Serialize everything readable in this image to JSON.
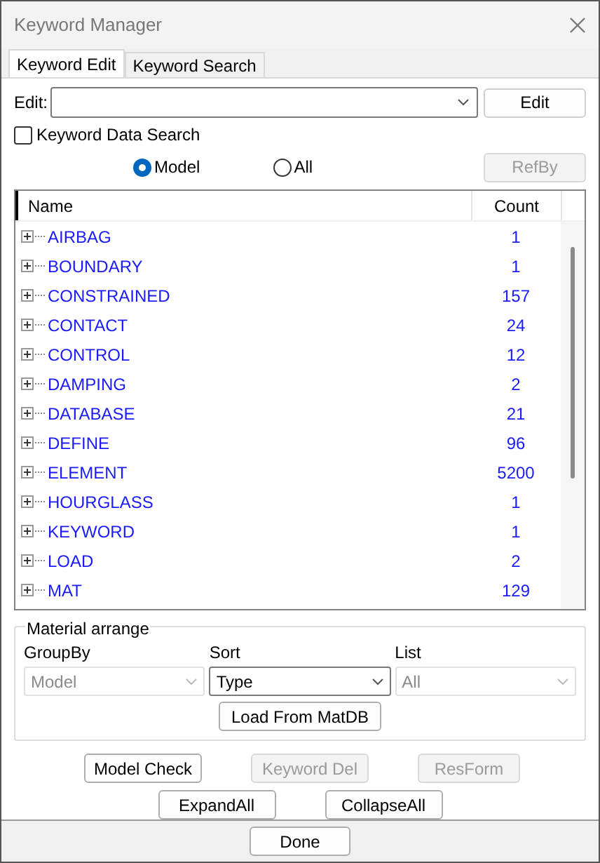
{
  "window": {
    "title": "Keyword Manager"
  },
  "tabs": [
    {
      "label": "Keyword Edit",
      "selected": true
    },
    {
      "label": "Keyword Search",
      "selected": false
    }
  ],
  "edit": {
    "label": "Edit:",
    "button": "Edit"
  },
  "data_search": {
    "label": "Keyword Data Search",
    "checked": false
  },
  "scope": [
    {
      "label": "Model",
      "selected": true
    },
    {
      "label": "All",
      "selected": false
    }
  ],
  "refby": {
    "label": "RefBy",
    "disabled": true
  },
  "tree": {
    "columns": [
      "Name",
      "Count"
    ],
    "rows": [
      {
        "name": "AIRBAG",
        "count": "1",
        "expanded": false
      },
      {
        "name": "BOUNDARY",
        "count": "1",
        "expanded": false
      },
      {
        "name": "CONSTRAINED",
        "count": "157",
        "expanded": false
      },
      {
        "name": "CONTACT",
        "count": "24",
        "expanded": false
      },
      {
        "name": "CONTROL",
        "count": "12",
        "expanded": false
      },
      {
        "name": "DAMPING",
        "count": "2",
        "expanded": false
      },
      {
        "name": "DATABASE",
        "count": "21",
        "expanded": false
      },
      {
        "name": "DEFINE",
        "count": "96",
        "expanded": false
      },
      {
        "name": "ELEMENT",
        "count": "5200",
        "expanded": false
      },
      {
        "name": "HOURGLASS",
        "count": "1",
        "expanded": false
      },
      {
        "name": "KEYWORD",
        "count": "1",
        "expanded": false
      },
      {
        "name": "LOAD",
        "count": "2",
        "expanded": false
      },
      {
        "name": "MAT",
        "count": "129",
        "expanded": false
      }
    ]
  },
  "material": {
    "title": "Material arrange",
    "dropdowns": [
      {
        "label": "GroupBy",
        "value": "Model",
        "disabled": true
      },
      {
        "label": "Sort",
        "value": "Type",
        "disabled": false
      },
      {
        "label": "List",
        "value": "All",
        "disabled": true
      }
    ],
    "button": "Load From MatDB"
  },
  "actions": [
    [
      {
        "label": "Model Check",
        "disabled": false
      },
      {
        "label": "Keyword Del",
        "disabled": true
      },
      {
        "label": "ResForm",
        "disabled": true
      }
    ],
    [
      {
        "label": "ExpandAll",
        "disabled": false
      },
      {
        "label": "CollapseAll",
        "disabled": false
      }
    ]
  ],
  "done": "Done"
}
